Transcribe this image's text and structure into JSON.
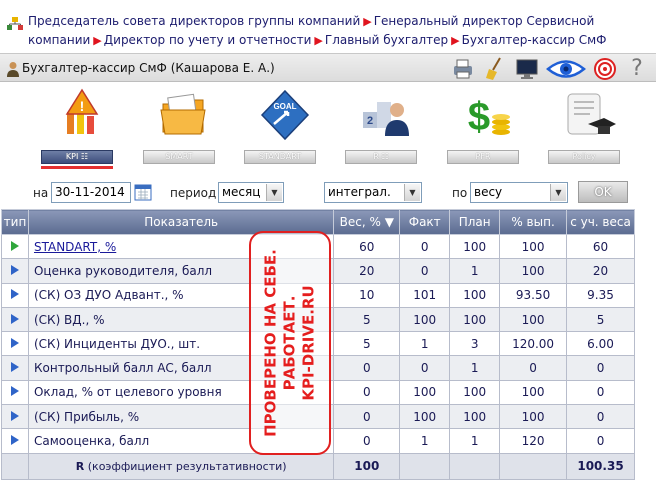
{
  "breadcrumb": {
    "items": [
      "Председатель совета директоров группы компаний",
      "Генеральный директор Сервисной компании",
      "Директор по учету и отчетности",
      "Главный бухгалтер",
      "Бухгалтер-кассир СмФ"
    ]
  },
  "user": {
    "title": "Бухгалтер-кассир СмФ   (Кашарова Е. А.)"
  },
  "toolbar": {
    "icons": [
      "printer-icon",
      "broom-icon",
      "monitor-icon",
      "eye-icon",
      "target-icon",
      "help-icon"
    ],
    "help_label": "?"
  },
  "modules": [
    {
      "label": "KPI ☷",
      "icon": "warning-chart-icon",
      "active": true
    },
    {
      "label": "SMART",
      "icon": "folder-icon",
      "active": false
    },
    {
      "label": "STANDART",
      "icon": "goal-icon",
      "active": false
    },
    {
      "label": "R ☷",
      "icon": "people-rank-icon",
      "active": false
    },
    {
      "label": "PFR",
      "icon": "money-icon",
      "active": false
    },
    {
      "label": "Policy",
      "icon": "diploma-icon",
      "active": false
    }
  ],
  "filters": {
    "date_label": "на",
    "date_value": "30-11-2014",
    "period_label": "период",
    "period_value": "месяц",
    "mode_value": "интеграл.",
    "by_label": "по",
    "by_value": "весу",
    "ok_label": "OK"
  },
  "table": {
    "headers": [
      "тип",
      "Показатель",
      "Вес, % ▼",
      "Факт",
      "План",
      "% вып.",
      "с уч. веса"
    ],
    "rows": [
      {
        "name": "STANDART, %",
        "weight": "60",
        "fact": "0",
        "plan": "100",
        "pct": "100",
        "weighted": "60",
        "link": true,
        "green": true
      },
      {
        "name": "Оценка руководителя, балл",
        "weight": "20",
        "fact": "0",
        "plan": "1",
        "pct": "100",
        "weighted": "20"
      },
      {
        "name": "(СК) ОЗ ДУО Адвант., %",
        "weight": "10",
        "fact": "101",
        "plan": "100",
        "pct": "93.50",
        "weighted": "9.35"
      },
      {
        "name": "(СК) ВД., %",
        "weight": "5",
        "fact": "100",
        "plan": "100",
        "pct": "100",
        "weighted": "5"
      },
      {
        "name": "(СК) Инциденты ДУО., шт.",
        "weight": "5",
        "fact": "1",
        "plan": "3",
        "pct": "120.00",
        "weighted": "6.00"
      },
      {
        "name": "Контрольный балл АС, балл",
        "weight": "0",
        "fact": "0",
        "plan": "1",
        "pct": "0",
        "weighted": "0"
      },
      {
        "name": "Оклад, % от целевого уровня",
        "weight": "0",
        "fact": "100",
        "plan": "100",
        "pct": "100",
        "weighted": "0"
      },
      {
        "name": "(СК) Прибыль, %",
        "weight": "0",
        "fact": "100",
        "plan": "100",
        "pct": "100",
        "weighted": "0"
      },
      {
        "name": "Самооценка, балл",
        "weight": "0",
        "fact": "1",
        "plan": "1",
        "pct": "120",
        "weighted": "0"
      }
    ],
    "footer": {
      "label_bold": "R",
      "label_rest": " (коэффициент результативности)",
      "weight_total": "100",
      "weighted_total": "100.35"
    }
  },
  "stamp": {
    "lines": [
      "ПРОВЕРЕНО НА СЕБЕ.",
      "РАБОТАЕТ.",
      "KPI-DRIVE.RU"
    ],
    "color": "#e51e1e"
  },
  "colors": {
    "accent": "#e53030",
    "header": "#5b6b90",
    "link": "#1a1a9a"
  }
}
